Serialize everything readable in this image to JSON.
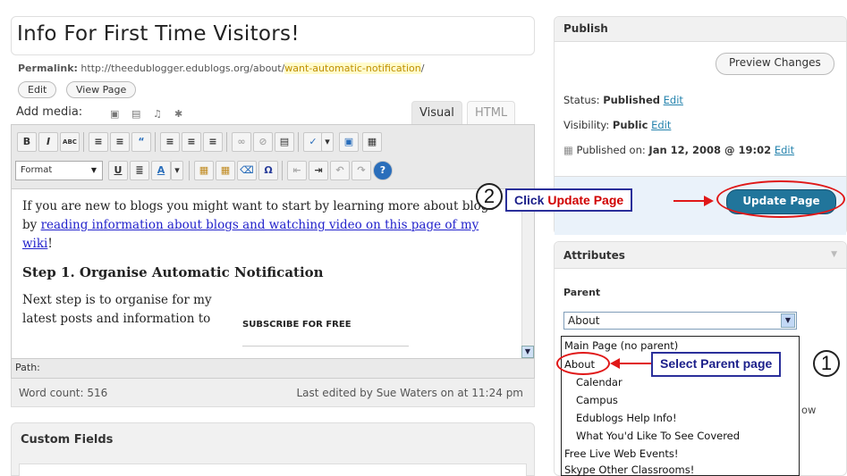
{
  "editor": {
    "title": "Info For First Time Visitors!",
    "permalink_label": "Permalink:",
    "permalink_base": "http://theedublogger.edublogs.org/about/",
    "permalink_slug": "want-automatic-notification",
    "permalink_end": "/",
    "edit_button": "Edit",
    "view_page_button": "View Page",
    "add_media_label": "Add media:",
    "tab_visual": "Visual",
    "tab_html": "HTML",
    "format_select": "Format",
    "toolbar_row1": [
      "B",
      "I",
      "ABC",
      "≡",
      "≡",
      "“",
      "≡",
      "≡",
      "≡",
      "∞",
      "⊘",
      "▤",
      "✓",
      "▾",
      "▣",
      "▦"
    ],
    "toolbar_row2": [
      "U",
      "≣",
      "A",
      "▾",
      "▦",
      "▦",
      "⌫",
      "Ω",
      "⇤",
      "⇥",
      "↶",
      "↷",
      "?"
    ],
    "content": {
      "intro_text": "If you are new to blogs you might want to start by learning more about blogs by ",
      "intro_link": "reading information about blogs and watching video on this page of my wiki",
      "intro_end": "!",
      "heading": "Step 1. Organise Automatic Notification",
      "body_text": "Next step is to organise for my latest posts and information to",
      "subscribe_text": "SUBSCRIBE FOR FREE"
    },
    "path_label": "Path:",
    "word_count": "Word count: 516",
    "last_edited": "Last edited by Sue Waters on at 11:24 pm"
  },
  "custom_fields": {
    "title": "Custom Fields"
  },
  "publish": {
    "title": "Publish",
    "preview_button": "Preview Changes",
    "status_label": "Status:",
    "status_value": "Published",
    "visibility_label": "Visibility:",
    "visibility_value": "Public",
    "published_on_label": "Published on:",
    "published_on_value": "Jan 12, 2008 @ 19:02",
    "edit_link": "Edit",
    "update_button": "Update Page"
  },
  "attributes": {
    "title": "Attributes",
    "parent_label": "Parent",
    "parent_selected": "About",
    "dropdown_items": [
      "Main Page (no parent)",
      "About",
      "Calendar",
      "Campus",
      "Edublogs Help Info!",
      "What You'd Like To See Covered",
      "Free Live Web Events!",
      "Skype Other Classrooms!"
    ],
    "partial_text": "ow"
  },
  "annotations": {
    "step1_number": "1",
    "step1_text": "Select Parent page",
    "step2_number": "2",
    "step2_text_prefix": "Click",
    "step2_text_highlight": "Update Page"
  },
  "colors": {
    "update_button": "#21759b",
    "annotation_red": "#e01818",
    "annotation_blue": "#1b1f8a",
    "link_blue": "#2583ad",
    "slug_highlight": "#fffbcc"
  }
}
